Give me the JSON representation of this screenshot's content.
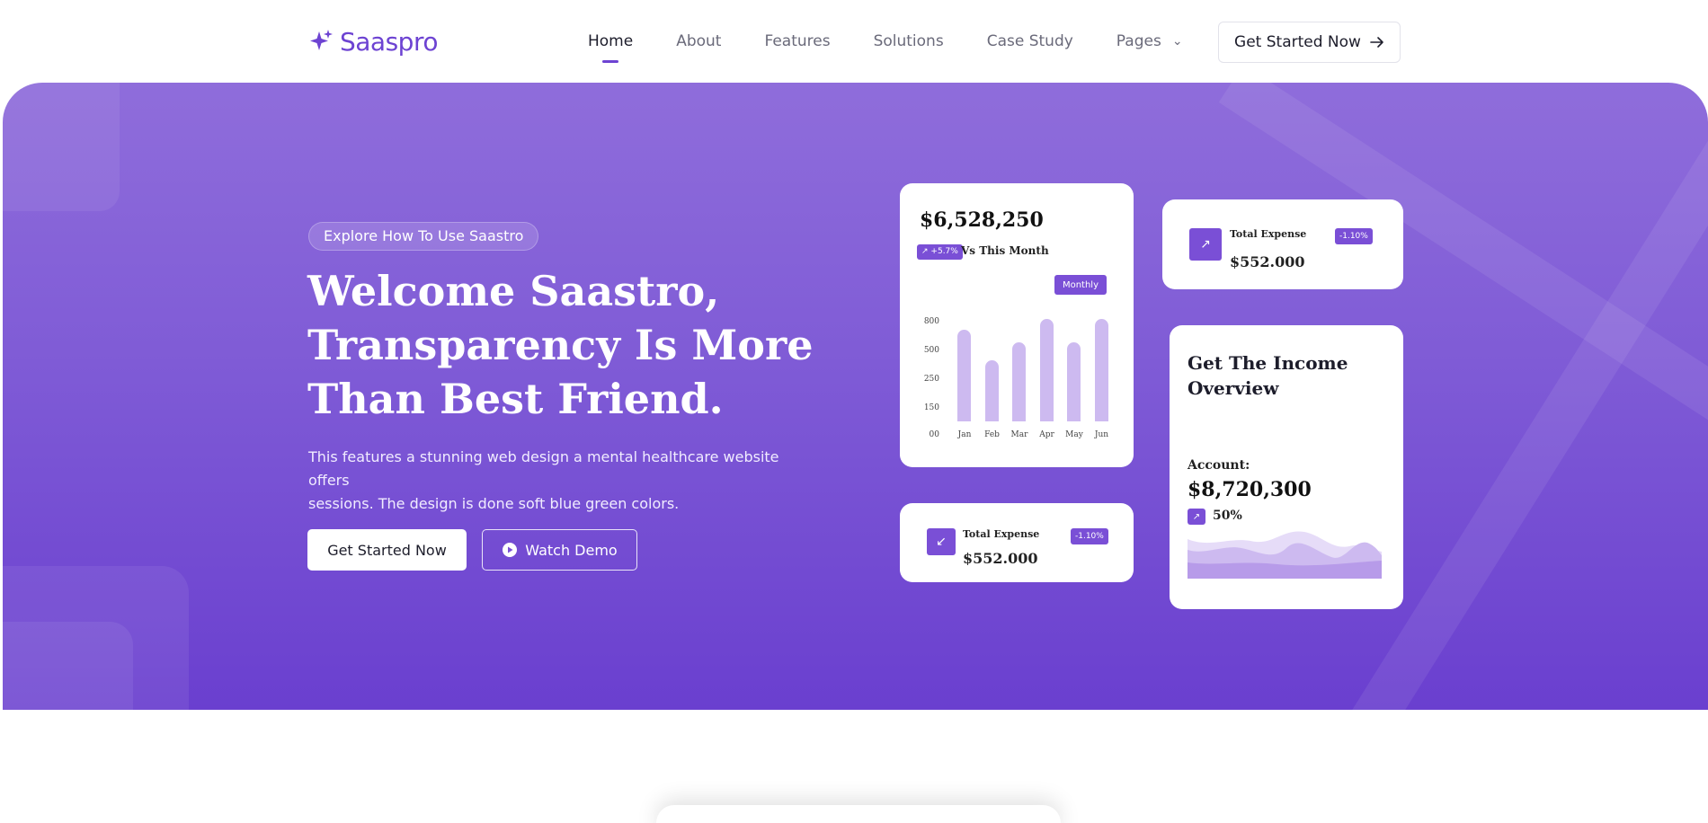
{
  "brand": {
    "name": "Saaspro",
    "accent": "#6d43d2"
  },
  "nav": {
    "items": [
      {
        "label": "Home",
        "active": true
      },
      {
        "label": "About",
        "active": false
      },
      {
        "label": "Features",
        "active": false
      },
      {
        "label": "Solutions",
        "active": false
      },
      {
        "label": "Case Study",
        "active": false
      },
      {
        "label": "Pages",
        "active": false,
        "dropdown": true
      }
    ],
    "cta_label": "Get Started Now",
    "cta_icon": "arrow-right-icon"
  },
  "hero": {
    "pill": "Explore How To Use Saastro",
    "title_lines": [
      "Welcome Saastro,",
      "Transparency Is More",
      "Than Best Friend."
    ],
    "description_lines": [
      "This features a stunning web design a mental healthcare website offers",
      "sessions. The design is done soft blue green colors."
    ],
    "primary_button": "Get Started Now",
    "secondary_button": "Watch Demo",
    "secondary_icon": "play-circle-icon",
    "gradient_top": "#8f6ddb",
    "gradient_bottom": "#6a3fcf"
  },
  "stats_card": {
    "amount": "$6,528,250",
    "change": "+5.7%",
    "change_label": "Vs This Month",
    "period_button": "Monthly"
  },
  "chart_data": {
    "type": "bar",
    "categories": [
      "Jan",
      "Feb",
      "Mar",
      "Apr",
      "May",
      "Jun"
    ],
    "values": [
      680,
      455,
      585,
      760,
      585,
      760
    ],
    "ytick_labels": [
      "800",
      "500",
      "250",
      "150",
      "00"
    ],
    "bar_color": "#cdbaf0"
  },
  "expense_top": {
    "label": "Total Expense",
    "value": "$552.000",
    "change": "-1.10%",
    "icon": "arrow-up-right-icon"
  },
  "expense_bottom": {
    "label": "Total Expense",
    "value": "$552.000",
    "change": "-1.10%",
    "icon": "arrow-down-left-icon"
  },
  "income_card": {
    "title": "Get The Income Overview",
    "account_label": "Account:",
    "account_value": "$8,720,300",
    "percent": "50%",
    "icon": "arrow-up-right-icon"
  }
}
